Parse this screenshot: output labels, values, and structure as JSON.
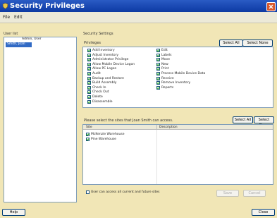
{
  "window": {
    "title": "Security Privileges"
  },
  "menu": [
    "File",
    "Edit"
  ],
  "users": {
    "label": "User list",
    "items": [
      "Admin, User",
      "Smith, Joan"
    ],
    "selected_index": 1
  },
  "settings": {
    "title": "Security Settings"
  },
  "privileges": {
    "label": "Privileges",
    "select_all": "Select All",
    "select_none": "Select None",
    "col1": [
      "Add Inventory",
      "Adjust Inventory",
      "Administrator Privilege",
      "Allow Mobile Device Logon",
      "Allow PC Logon",
      "Audit",
      "Backup and Restore",
      "Build Assembly",
      "Check In",
      "Check Out",
      "Delete",
      "Disassemble"
    ],
    "col2": [
      "Edit",
      "Labels",
      "Move",
      "New",
      "Print",
      "Process Mobile Device Data",
      "Receive",
      "Remove Inventory",
      "Reports"
    ]
  },
  "sites": {
    "instruction": "Please select the sites that Joan Smith can access.",
    "select_all": "Select All",
    "select_none": "Select None",
    "headers": [
      "Site",
      "Description"
    ],
    "items": [
      "McKenzie Warehouse",
      "Pine Warehouse"
    ]
  },
  "access_all": "User can access all current and future sites",
  "buttons": {
    "save": "Save",
    "cancel": "Cancel",
    "help": "Help",
    "close": "Close"
  }
}
